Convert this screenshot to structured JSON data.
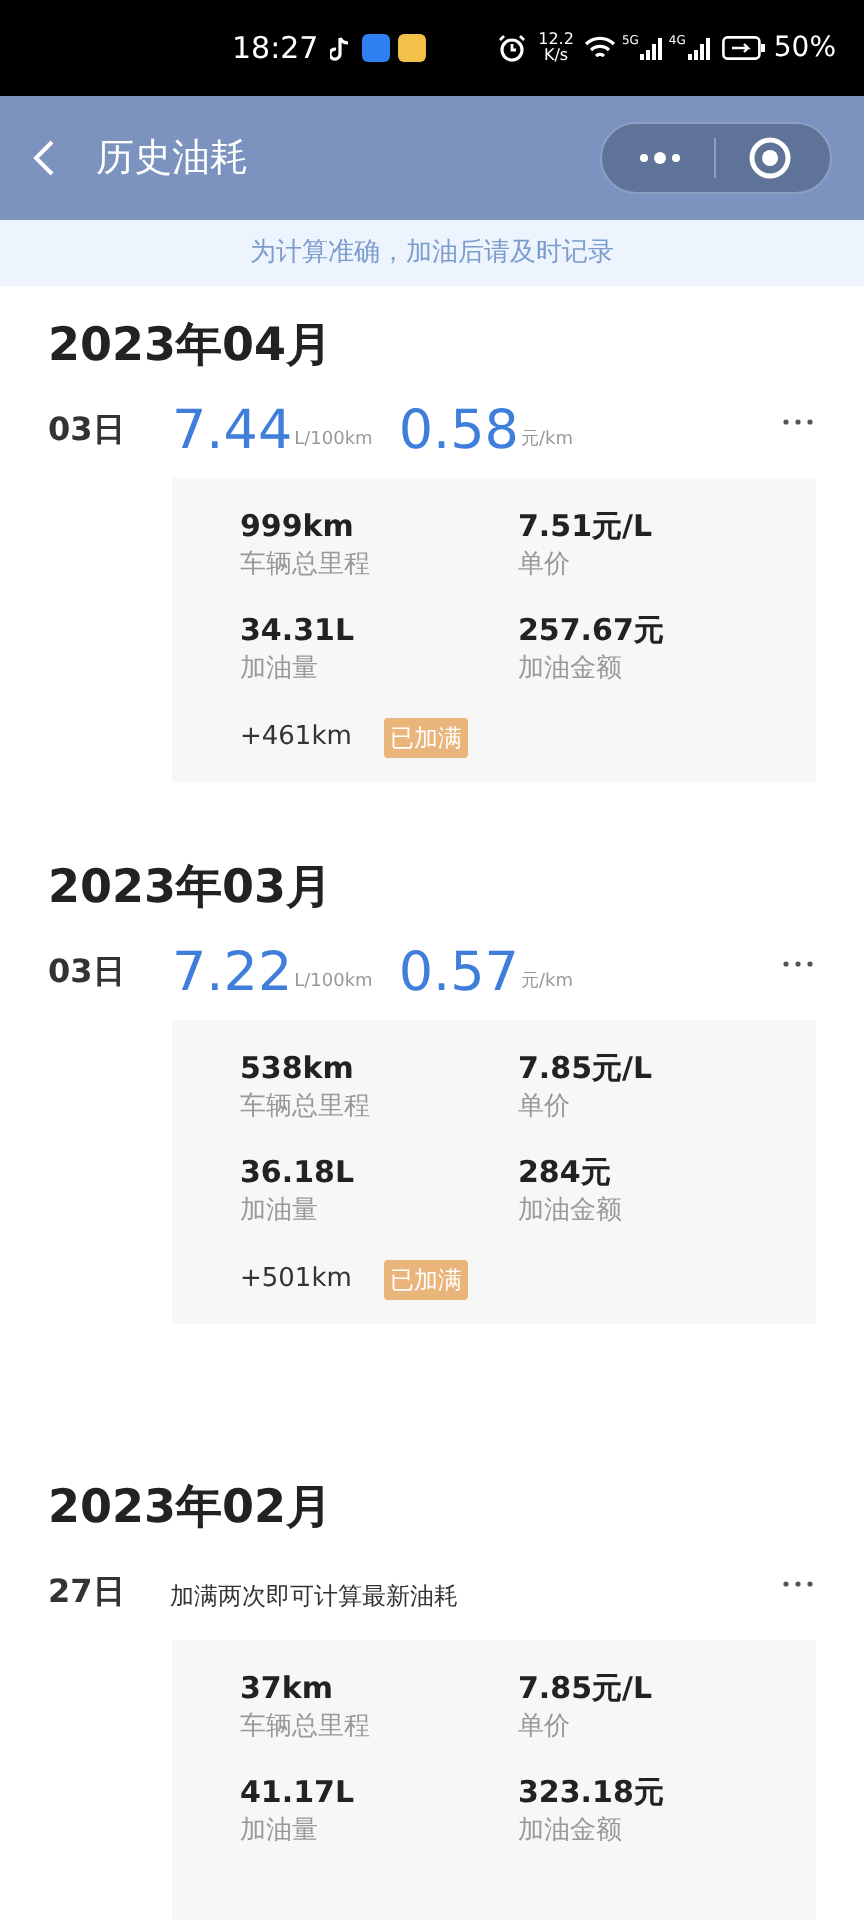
{
  "status_bar": {
    "time": "18:27",
    "speed": "12.2",
    "speed_unit": "K/s",
    "net_1": "5G",
    "net_2": "4G",
    "battery": "50%"
  },
  "nav": {
    "title": "历史油耗"
  },
  "notice": "为计算准确，加油后请及时记录",
  "months": [
    {
      "title": "2023年04月",
      "entries": [
        {
          "kind": "consumption",
          "day": "03日",
          "consumption": "7.44",
          "consumption_unit": "L/100km",
          "cost": "0.58",
          "cost_unit": "元/km",
          "stats": [
            {
              "value": "999km",
              "label": "车辆总里程"
            },
            {
              "value": "7.51元/L",
              "label": "单价"
            },
            {
              "value": "34.31L",
              "label": "加油量"
            },
            {
              "value": "257.67元",
              "label": "加油金额"
            }
          ],
          "distance": "+461km",
          "badge": "已加满"
        }
      ]
    },
    {
      "title": "2023年03月",
      "entries": [
        {
          "kind": "consumption",
          "day": "03日",
          "consumption": "7.22",
          "consumption_unit": "L/100km",
          "cost": "0.57",
          "cost_unit": "元/km",
          "stats": [
            {
              "value": "538km",
              "label": "车辆总里程"
            },
            {
              "value": "7.85元/L",
              "label": "单价"
            },
            {
              "value": "36.18L",
              "label": "加油量"
            },
            {
              "value": "284元",
              "label": "加油金额"
            }
          ],
          "distance": "+501km",
          "badge": "已加满"
        }
      ]
    },
    {
      "title": "2023年02月",
      "entries": [
        {
          "kind": "note",
          "day": "27日",
          "note": "加满两次即可计算最新油耗",
          "stats": [
            {
              "value": "37km",
              "label": "车辆总里程"
            },
            {
              "value": "7.85元/L",
              "label": "单价"
            },
            {
              "value": "41.17L",
              "label": "加油量"
            },
            {
              "value": "323.18元",
              "label": "加油金额"
            }
          ]
        }
      ]
    }
  ]
}
